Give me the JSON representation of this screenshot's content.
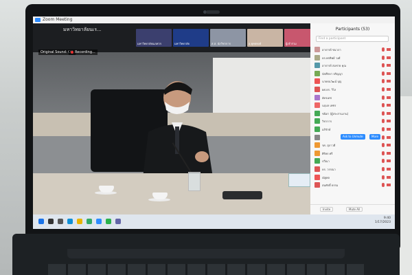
{
  "window": {
    "title": "Zoom Meeting"
  },
  "meeting": {
    "name": "มหาวิทยาลัยนเร...",
    "audio_badge": "Original Sound: Off",
    "recording_label": "Recording..."
  },
  "thumbnails": [
    {
      "label": "มหาวิทยาลัยนเรศวร",
      "color": "#3b3f6e"
    },
    {
      "label": "มหาวิทยาลัย",
      "color": "#1f3c88"
    },
    {
      "label": "ส.ส. นักวิชาการ",
      "color": "#8d95a4"
    },
    {
      "label": "อ.ยุทธพงษ์",
      "color": "#c9b5a4"
    },
    {
      "label": "ผู้เข้าร่วม",
      "color": "#c8576e"
    }
  ],
  "participants": {
    "title": "Participants (53)",
    "search_placeholder": "Find a participant",
    "rows": [
      {
        "name": "อาจารย์ ชนาภา",
        "color": "#c99"
      },
      {
        "name": "ดร.พรทิพย์ วงศ์",
        "color": "#aa8"
      },
      {
        "name": "อาจารย์ สมชาย คุณ",
        "color": "#59a"
      },
      {
        "name": "นักศึกษา ปริญญา",
        "color": "#7a5"
      },
      {
        "name": "นายธนวัฒน์ บุญ",
        "color": "#e55"
      },
      {
        "name": "ผศ.ดร. วิไล",
        "color": "#d55"
      },
      {
        "name": "อัครเดช",
        "color": "#a7c"
      },
      {
        "name": "นฤมล เพชร",
        "color": "#e66"
      },
      {
        "name": "ชนิดา (ผู้ประสานงาน)",
        "color": "#4a5"
      },
      {
        "name": "วิชาการ",
        "color": "#4a5"
      },
      {
        "name": "อภิรักษ์",
        "color": "#4a5"
      },
      {
        "name": "",
        "color": "#888",
        "buttons": true
      },
      {
        "name": "รศ. สุภาวดี",
        "color": "#e93"
      },
      {
        "name": "ศิริพร ศรี",
        "color": "#e93"
      },
      {
        "name": "ปวีณา",
        "color": "#4a5"
      },
      {
        "name": "ดร. วรรณา",
        "color": "#d55"
      },
      {
        "name": "ณัฐพล",
        "color": "#e55"
      },
      {
        "name": "สมศักดิ์ ธรรม",
        "color": "#d55"
      }
    ],
    "ask_to_unmute_label": "Ask to Unmute",
    "more_label": "More",
    "invite_label": "Invite",
    "mute_all_label": "Mute All"
  },
  "taskbar": {
    "icons": [
      "windows-icon",
      "search-icon",
      "taskview-icon",
      "edge-icon",
      "explorer-icon",
      "store-icon",
      "zoom-icon",
      "line-icon",
      "teams-icon"
    ],
    "icon_colors": [
      "#1a73e8",
      "#333",
      "#555",
      "#0f8fd6",
      "#e8b400",
      "#3a6",
      "#2d8cff",
      "#2bb24c",
      "#6264a7"
    ],
    "time": "9:40",
    "date": "1/17/2023"
  }
}
